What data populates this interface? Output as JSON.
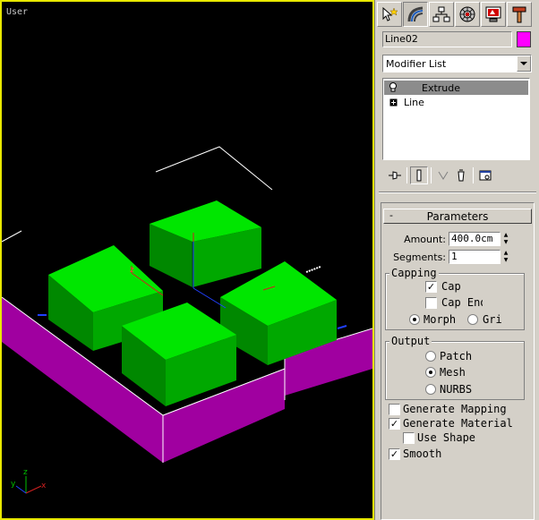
{
  "viewport": {
    "label": "User",
    "border_color": "#e8e800",
    "axis_labels": {
      "x": "x",
      "y": "y",
      "z": "z"
    }
  },
  "colors": {
    "box_green": "#00e600",
    "base_magenta": "#a000a0",
    "object_color": "#ff00ff"
  },
  "command_panel": {
    "tabs": [
      {
        "name": "create-tab",
        "icon": "cursor-star-icon"
      },
      {
        "name": "modify-tab",
        "icon": "bent-rainbow-icon",
        "active": true
      },
      {
        "name": "hierarchy-tab",
        "icon": "hierarchy-icon"
      },
      {
        "name": "motion-tab",
        "icon": "wheel-icon"
      },
      {
        "name": "display-tab",
        "icon": "monitor-icon"
      },
      {
        "name": "utilities-tab",
        "icon": "hammer-icon"
      }
    ],
    "object_name": "Line02",
    "modifier_list_label": "Modifier List",
    "stack": [
      {
        "label": "Extrude",
        "selected": true
      },
      {
        "label": "Line",
        "expandable": true
      }
    ]
  },
  "parameters": {
    "title": "Parameters",
    "collapse_symbol": "-",
    "amount_label": "Amount:",
    "amount_value": "400.0cm",
    "segments_label": "Segments:",
    "segments_value": "1",
    "capping": {
      "title": "Capping",
      "cap_start": {
        "label": "Cap",
        "checked": true
      },
      "cap_end": {
        "label": "Cap End",
        "checked": false
      },
      "morph": {
        "label": "Morph",
        "selected": true
      },
      "grid": {
        "label": "Grid",
        "selected": false
      }
    },
    "output": {
      "title": "Output",
      "patch": {
        "label": "Patch",
        "selected": false
      },
      "mesh": {
        "label": "Mesh",
        "selected": true
      },
      "nurbs": {
        "label": "NURBS",
        "selected": false
      }
    },
    "generate_mapping": {
      "label": "Generate Mapping",
      "checked": false
    },
    "generate_material": {
      "label": "Generate Material",
      "checked": true
    },
    "use_shape": {
      "label": "Use Shape",
      "checked": false
    },
    "smooth": {
      "label": "Smooth",
      "checked": true
    }
  }
}
